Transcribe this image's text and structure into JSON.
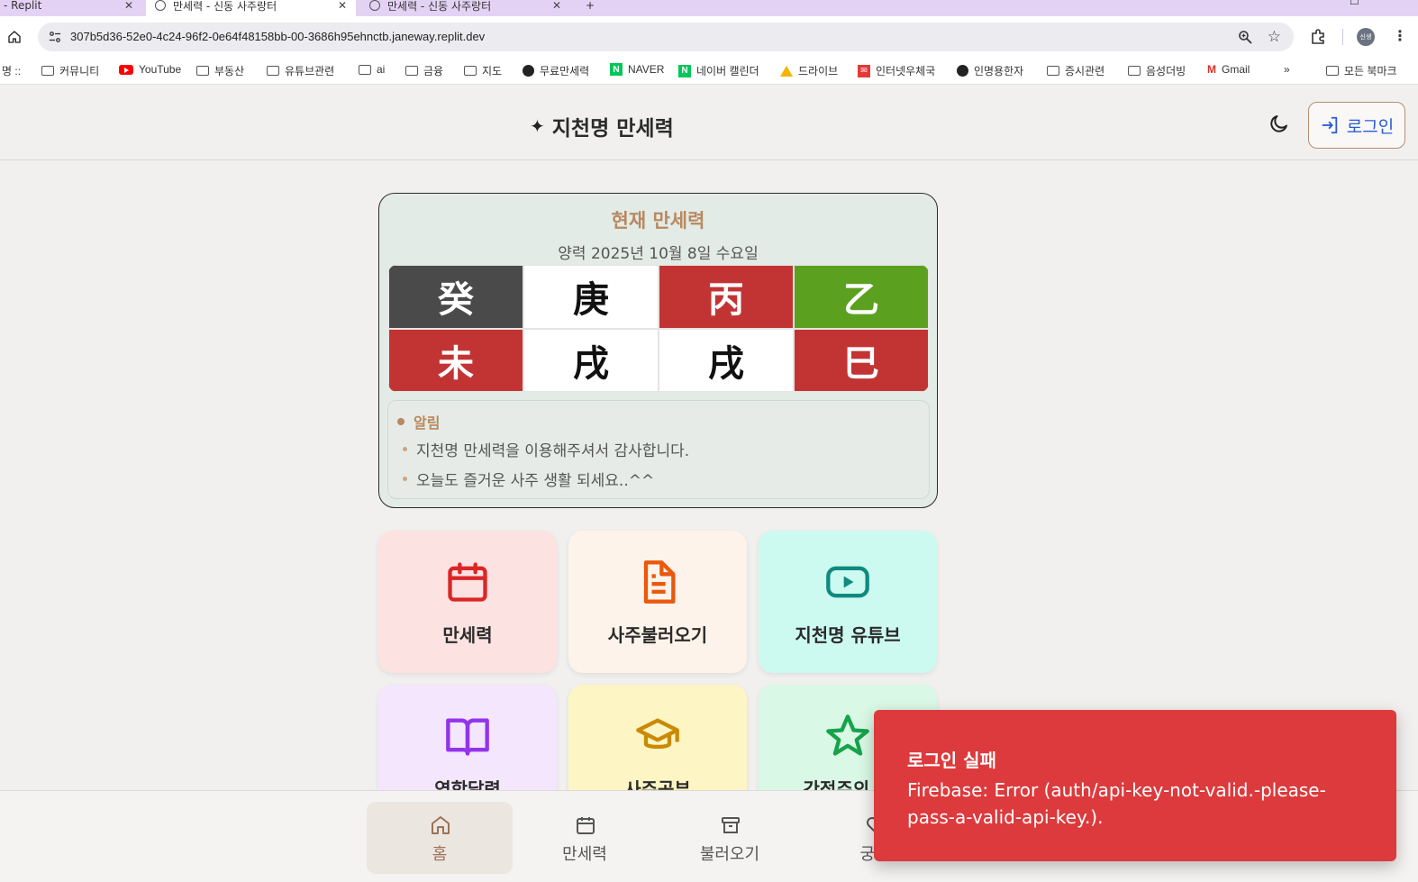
{
  "browser": {
    "tabs": [
      {
        "title": "- Replit"
      },
      {
        "title": "만세력 - 신동 사주랑터"
      },
      {
        "title": "만세력 - 신동 사주랑터"
      }
    ],
    "new_tab": "+",
    "url": "307b5d36-52e0-4c24-96f2-0e64f48158bb-00-3686h95ehnctb.janeway.replit.dev",
    "profile_label": "신생",
    "bookmarks": [
      {
        "label": "명 ::",
        "icon": "none"
      },
      {
        "label": "커뮤니티",
        "icon": "folder-icon"
      },
      {
        "label": "YouTube",
        "icon": "youtube-icon"
      },
      {
        "label": "부동산",
        "icon": "folder-icon"
      },
      {
        "label": "유튜브관련",
        "icon": "folder-icon"
      },
      {
        "label": "ai",
        "icon": "folder-icon"
      },
      {
        "label": "금융",
        "icon": "folder-icon"
      },
      {
        "label": "지도",
        "icon": "folder-icon"
      },
      {
        "label": "무료만세력",
        "icon": "globe-icon"
      },
      {
        "label": "NAVER",
        "icon": "naver-icon"
      },
      {
        "label": "네이버 캘린더",
        "icon": "naver-icon"
      },
      {
        "label": "드라이브",
        "icon": "drive-icon"
      },
      {
        "label": "인터넷우체국",
        "icon": "post-icon"
      },
      {
        "label": "인명용한자",
        "icon": "globe-icon"
      },
      {
        "label": "증시관련",
        "icon": "folder-icon"
      },
      {
        "label": "음성더빙",
        "icon": "folder-icon"
      },
      {
        "label": "Gmail",
        "icon": "gmail-icon"
      }
    ],
    "bookmarks_more": "»",
    "all_bookmarks": "모든 북마크"
  },
  "header": {
    "title": "지천명 만세력",
    "login_label": "로그인"
  },
  "manse": {
    "title": "현재 만세력",
    "date": "양력 2025년 10월 8일 수요일",
    "stems": [
      {
        "char": "癸",
        "bg": "#4a4a4a",
        "fg": "#ffffff"
      },
      {
        "char": "庚",
        "bg": "#ffffff",
        "fg": "#111111"
      },
      {
        "char": "丙",
        "bg": "#c23434",
        "fg": "#ffffff"
      },
      {
        "char": "乙",
        "bg": "#5ba11f",
        "fg": "#ffffff"
      }
    ],
    "branches": [
      {
        "char": "未",
        "bg": "#c23434",
        "fg": "#ffffff"
      },
      {
        "char": "戌",
        "bg": "#ffffff",
        "fg": "#111111"
      },
      {
        "char": "戌",
        "bg": "#ffffff",
        "fg": "#111111"
      },
      {
        "char": "巳",
        "bg": "#c23434",
        "fg": "#ffffff"
      }
    ],
    "notice": {
      "heading": "알림",
      "lines": [
        "지천명 만세력을 이용해주셔서 감사합니다.",
        "오늘도 즐거운 사주 생활 되세요..^^"
      ]
    }
  },
  "tiles": [
    {
      "label": "만세력",
      "icon": "calendar-icon",
      "bg": "#fde2e2",
      "color": "#dc2626"
    },
    {
      "label": "사주불러오기",
      "icon": "document-icon",
      "bg": "#fef3ea",
      "color": "#ea580c"
    },
    {
      "label": "지천명 유튜브",
      "icon": "youtube-play-icon",
      "bg": "#cdfaf0",
      "color": "#0f8a80"
    },
    {
      "label": "역학달력",
      "icon": "book-icon",
      "bg": "#f3e6fd",
      "color": "#9333ea"
    },
    {
      "label": "사주공부",
      "icon": "graduation-cap-icon",
      "bg": "#fdf6c4",
      "color": "#ca8a04"
    },
    {
      "label": "간접주의 신",
      "icon": "star-icon",
      "bg": "#daf8e6",
      "color": "#16a34a"
    }
  ],
  "bottom_nav": [
    {
      "label": "홈",
      "icon": "home-icon",
      "active": true
    },
    {
      "label": "만세력",
      "icon": "calendar-icon",
      "active": false
    },
    {
      "label": "불러오기",
      "icon": "archive-icon",
      "active": false
    },
    {
      "label": "궁합",
      "icon": "heart-icon",
      "active": false
    }
  ],
  "toast": {
    "title": "로그인 실패",
    "message": "Firebase: Error (auth/api-key-not-valid.-please-pass-a-valid-api-key.)."
  }
}
